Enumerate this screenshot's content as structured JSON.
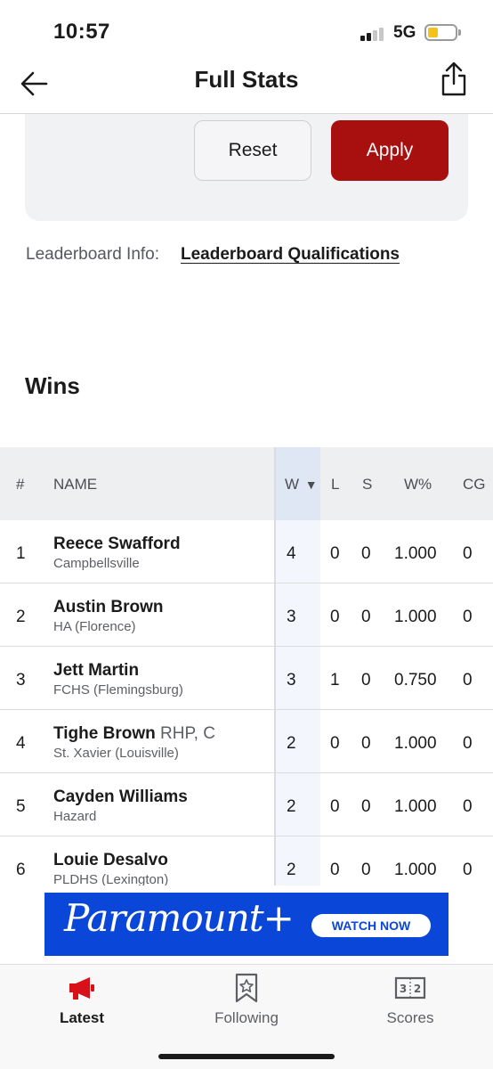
{
  "status": {
    "time": "10:57",
    "network": "5G"
  },
  "nav": {
    "title": "Full Stats"
  },
  "filters": {
    "reset_label": "Reset",
    "apply_label": "Apply"
  },
  "leaderboard": {
    "info_label": "Leaderboard Info:",
    "link_label": "Leaderboard Qualifications"
  },
  "section": {
    "title": "Wins"
  },
  "table": {
    "headers": {
      "rank": "#",
      "name": "NAME",
      "w": "W",
      "sort_indicator": "▼",
      "l": "L",
      "s": "S",
      "wpct": "W%",
      "cg": "CG"
    },
    "rows": [
      {
        "rank": "1",
        "name": "Reece Swafford",
        "position": "",
        "school": "Campbellsville",
        "w": "4",
        "l": "0",
        "s": "0",
        "wpct": "1.000",
        "cg": "0"
      },
      {
        "rank": "2",
        "name": "Austin Brown",
        "position": "",
        "school": "HA (Florence)",
        "w": "3",
        "l": "0",
        "s": "0",
        "wpct": "1.000",
        "cg": "0"
      },
      {
        "rank": "3",
        "name": "Jett Martin",
        "position": "",
        "school": "FCHS (Flemingsburg)",
        "w": "3",
        "l": "1",
        "s": "0",
        "wpct": "0.750",
        "cg": "0"
      },
      {
        "rank": "4",
        "name": "Tighe Brown",
        "position": "RHP, C",
        "school": "St. Xavier (Louisville)",
        "w": "2",
        "l": "0",
        "s": "0",
        "wpct": "1.000",
        "cg": "0"
      },
      {
        "rank": "5",
        "name": "Cayden Williams",
        "position": "",
        "school": "Hazard",
        "w": "2",
        "l": "0",
        "s": "0",
        "wpct": "1.000",
        "cg": "0"
      },
      {
        "rank": "6",
        "name": "Louie Desalvo",
        "position": "",
        "school": "PLDHS (Lexington)",
        "w": "2",
        "l": "0",
        "s": "0",
        "wpct": "1.000",
        "cg": "0"
      }
    ]
  },
  "ad": {
    "brand": "Paramount+",
    "cta": "WATCH NOW"
  },
  "tabs": [
    {
      "label": "Latest",
      "icon": "megaphone-icon",
      "active": true
    },
    {
      "label": "Following",
      "icon": "bookmark-star-icon",
      "active": false
    },
    {
      "label": "Scores",
      "icon": "scoreboard-icon",
      "active": false
    }
  ],
  "colors": {
    "accent": "#a80f0f",
    "ad_blue": "#0a47d8",
    "battery": "#f4c21a"
  }
}
